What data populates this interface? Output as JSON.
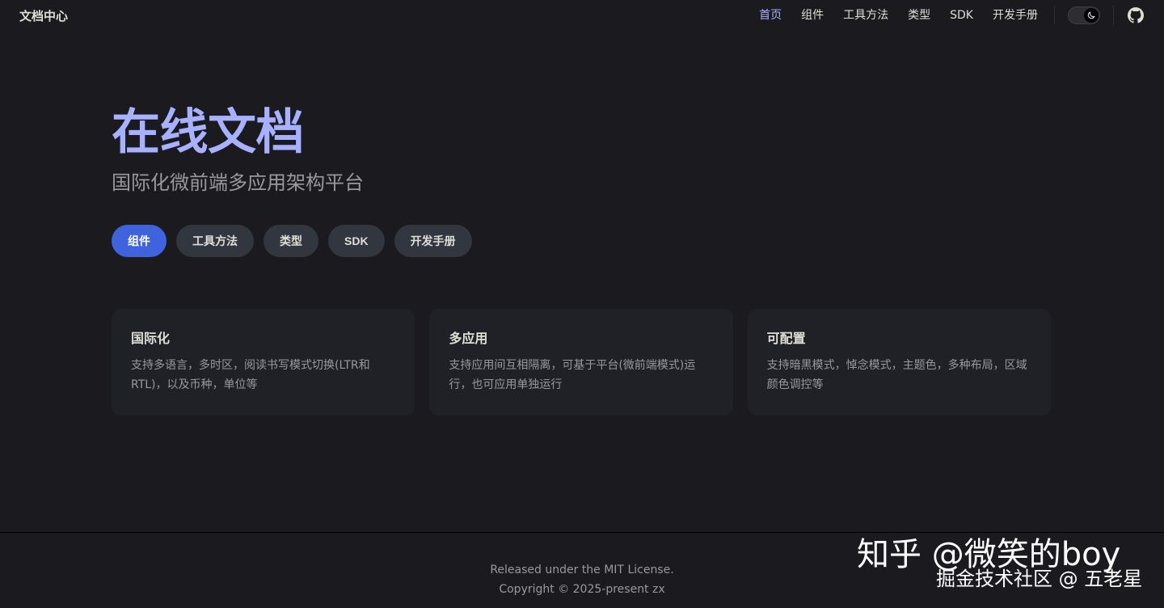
{
  "nav": {
    "brand": "文档中心",
    "links": [
      {
        "label": "首页",
        "active": true
      },
      {
        "label": "组件",
        "active": false
      },
      {
        "label": "工具方法",
        "active": false
      },
      {
        "label": "类型",
        "active": false
      },
      {
        "label": "SDK",
        "active": false
      },
      {
        "label": "开发手册",
        "active": false
      }
    ],
    "theme_toggle_icon": "moon-icon",
    "repo_icon": "github-icon"
  },
  "hero": {
    "title": "在线文档",
    "tagline": "国际化微前端多应用架构平台",
    "actions": [
      {
        "label": "组件",
        "theme": "brand"
      },
      {
        "label": "工具方法",
        "theme": "alt"
      },
      {
        "label": "类型",
        "theme": "alt"
      },
      {
        "label": "SDK",
        "theme": "alt"
      },
      {
        "label": "开发手册",
        "theme": "alt"
      }
    ]
  },
  "features": [
    {
      "title": "国际化",
      "details": "支持多语言，多时区，阅读书写模式切换(LTR和RTL)，以及币种，单位等"
    },
    {
      "title": "多应用",
      "details": "支持应用间互相隔离，可基于平台(微前端模式)运行，也可应用单独运行"
    },
    {
      "title": "可配置",
      "details": "支持暗黑模式，悼念模式，主题色，多种布局，区域颜色调控等"
    }
  ],
  "footer": {
    "message": "Released under the MIT License.",
    "copyright": "Copyright © 2025-present zx"
  },
  "watermark": {
    "main": "知乎 @微笑的boy",
    "sub": "掘金技术社区 @ 五老星"
  },
  "colors": {
    "background": "#1b1b1f",
    "brand": "#3e63dd",
    "title": "#a8b1ff",
    "card": "#202127"
  }
}
